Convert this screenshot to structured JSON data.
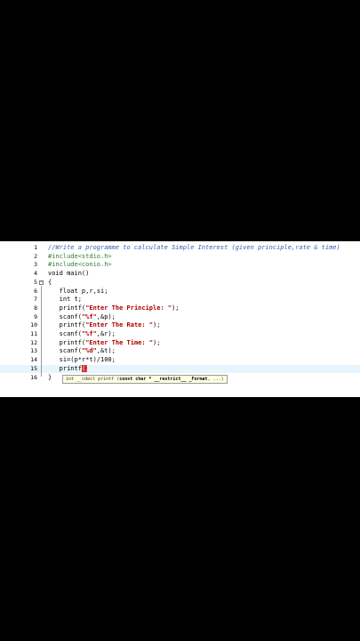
{
  "editor": {
    "lines": [
      {
        "num": "1",
        "segments": [
          {
            "cls": "comment",
            "text": "//Write a programme to calculate Simple Interest (given principle,rate & time)"
          }
        ]
      },
      {
        "num": "2",
        "segments": [
          {
            "cls": "pp",
            "text": "#include<stdio.h>"
          }
        ]
      },
      {
        "num": "3",
        "segments": [
          {
            "cls": "pp",
            "text": "#include<conio.h>"
          }
        ]
      },
      {
        "num": "4",
        "segments": [
          {
            "cls": "kw",
            "text": "void main()"
          }
        ]
      },
      {
        "num": "5",
        "segments": [
          {
            "cls": "kw",
            "text": "{"
          }
        ]
      },
      {
        "num": "6",
        "segments": [
          {
            "cls": "kw",
            "text": "   float p,r,si;"
          }
        ]
      },
      {
        "num": "7",
        "segments": [
          {
            "cls": "kw",
            "text": "   int t;"
          }
        ]
      },
      {
        "num": "8",
        "segments": [
          {
            "cls": "fn",
            "text": "   printf("
          },
          {
            "cls": "str",
            "text": "\"Enter The Principle: \""
          },
          {
            "cls": "fn",
            "text": ");"
          }
        ]
      },
      {
        "num": "9",
        "segments": [
          {
            "cls": "fn",
            "text": "   scanf("
          },
          {
            "cls": "str",
            "text": "\"%f\""
          },
          {
            "cls": "fn",
            "text": ",&p);"
          }
        ]
      },
      {
        "num": "10",
        "segments": [
          {
            "cls": "fn",
            "text": "   printf("
          },
          {
            "cls": "str",
            "text": "\"Enter The Rate: \""
          },
          {
            "cls": "fn",
            "text": ");"
          }
        ]
      },
      {
        "num": "11",
        "segments": [
          {
            "cls": "fn",
            "text": "   scanf("
          },
          {
            "cls": "str",
            "text": "\"%f\""
          },
          {
            "cls": "fn",
            "text": ",&r);"
          }
        ]
      },
      {
        "num": "12",
        "segments": [
          {
            "cls": "fn",
            "text": "   printf("
          },
          {
            "cls": "str",
            "text": "\"Enter The Time: \""
          },
          {
            "cls": "fn",
            "text": ");"
          }
        ]
      },
      {
        "num": "13",
        "segments": [
          {
            "cls": "fn",
            "text": "   scanf("
          },
          {
            "cls": "str",
            "text": "\"%d\""
          },
          {
            "cls": "fn",
            "text": ",&t);"
          }
        ]
      },
      {
        "num": "14",
        "segments": [
          {
            "cls": "fn",
            "text": "   si=(p*r*t)/100;"
          }
        ]
      },
      {
        "num": "15",
        "segments": [
          {
            "cls": "fn",
            "text": "   printf"
          }
        ],
        "cursor": "()",
        "current": true
      },
      {
        "num": "16",
        "segments": [
          {
            "cls": "kw",
            "text": "}"
          }
        ]
      }
    ],
    "tooltip": {
      "prefix": "int __cdecl printf (",
      "param": "const char * __restrict__ _Format",
      "suffix": ", ...)"
    }
  }
}
